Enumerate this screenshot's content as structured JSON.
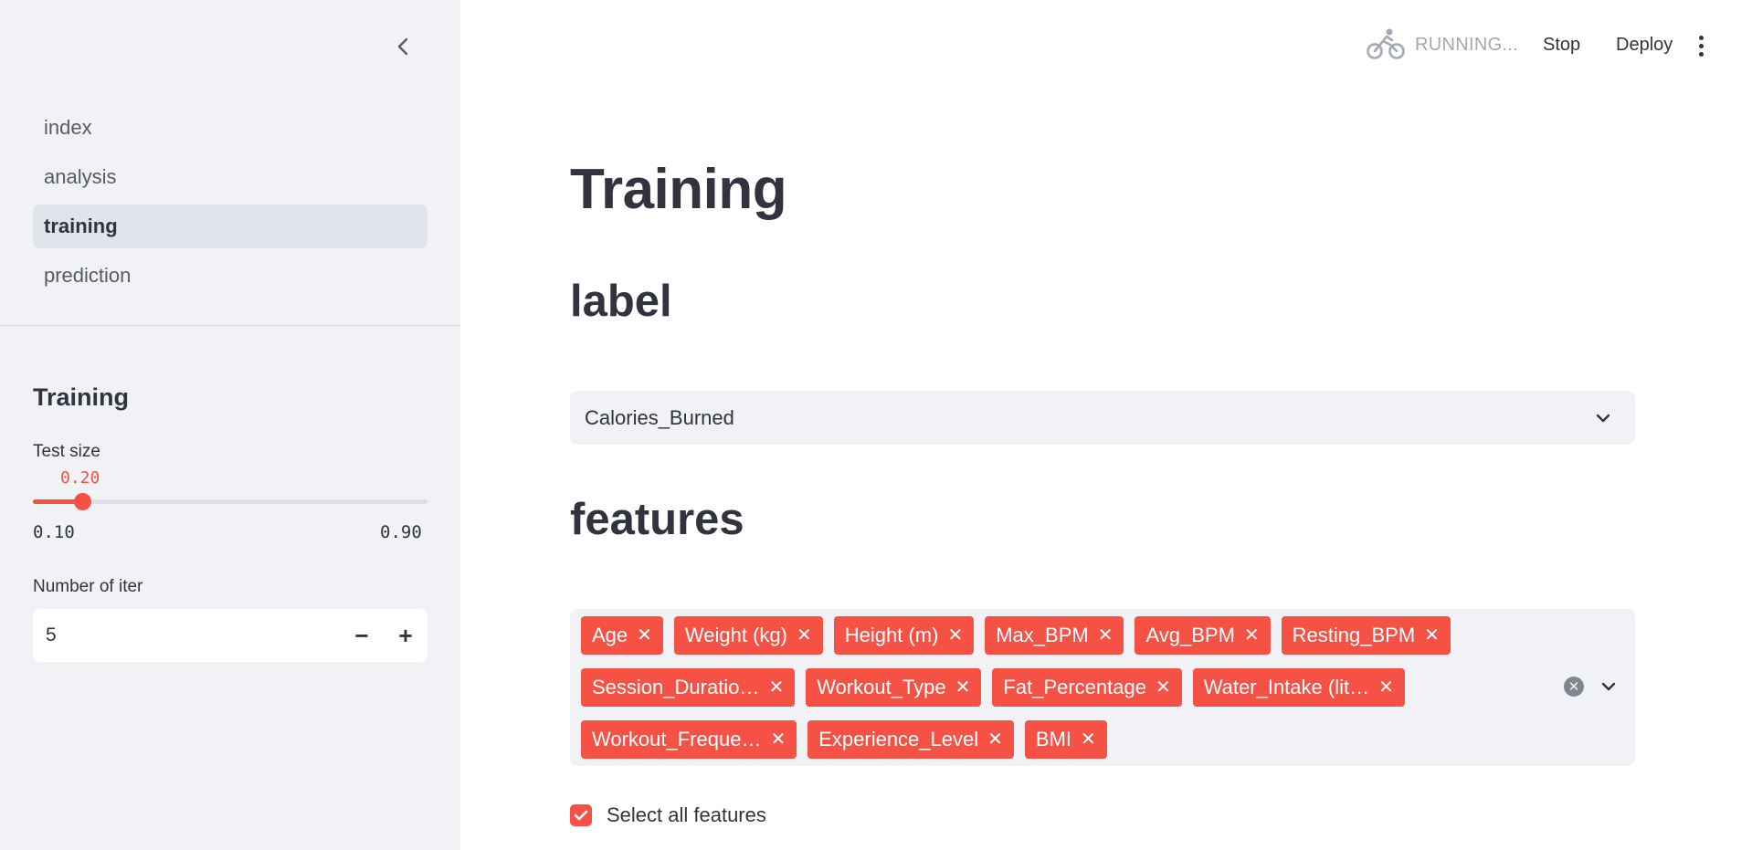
{
  "sidebar": {
    "nav": [
      {
        "label": "index",
        "active": false
      },
      {
        "label": "analysis",
        "active": false
      },
      {
        "label": "training",
        "active": true
      },
      {
        "label": "prediction",
        "active": false
      }
    ],
    "heading": "Training",
    "test_size": {
      "label": "Test size",
      "value": "0.20",
      "value_num": 0.2,
      "min": "0.10",
      "max": "0.90",
      "min_num": 0.1,
      "max_num": 0.9
    },
    "iterations": {
      "label": "Number of iter",
      "value": "5",
      "minus": "−",
      "plus": "+"
    }
  },
  "header": {
    "status": "RUNNING...",
    "stop": "Stop",
    "deploy": "Deploy"
  },
  "main": {
    "title": "Training",
    "label_heading": "label",
    "label_value": "Calories_Burned",
    "features_heading": "features",
    "features": [
      "Age",
      "Weight (kg)",
      "Height (m)",
      "Max_BPM",
      "Avg_BPM",
      "Resting_BPM",
      "Session_Duratio…",
      "Workout_Type",
      "Fat_Percentage",
      "Water_Intake (lit…",
      "Workout_Freque…",
      "Experience_Level",
      "BMI"
    ],
    "select_all_label": "Select all features",
    "select_all_checked": true
  },
  "colors": {
    "accent": "#f55145",
    "sidebar_bg": "#f0f2f6",
    "text": "#31333f",
    "muted": "#a3a8b4"
  }
}
